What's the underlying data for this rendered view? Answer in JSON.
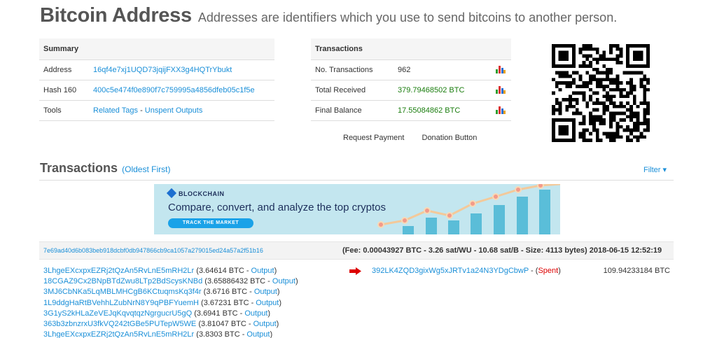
{
  "page": {
    "title": "Bitcoin Address",
    "subtitle": "Addresses are identifiers which you use to send bitcoins to another person."
  },
  "summary": {
    "header": "Summary",
    "address_label": "Address",
    "address_value": "16qf4e7xj1UQD73jqijFXX3g4HQTrYbukt",
    "hash160_label": "Hash 160",
    "hash160_value": "400c5e474f0e890f7c759995a4856dfeb05c1f5e",
    "tools_label": "Tools",
    "tools_link1": "Related Tags",
    "tools_sep": " - ",
    "tools_link2": "Unspent Outputs"
  },
  "transactions_summary": {
    "header": "Transactions",
    "no_tx_label": "No. Transactions",
    "no_tx_value": "962",
    "total_received_label": "Total Received",
    "total_received_value": "379.79468502 BTC",
    "final_balance_label": "Final Balance",
    "final_balance_value": "17.55084862 BTC",
    "chart_icon": "bar-chart-icon"
  },
  "actions": {
    "request_payment": "Request Payment",
    "donation_button": "Donation Button"
  },
  "qr_code": {
    "icon": "qr-code-icon"
  },
  "tx_list": {
    "title": "Transactions",
    "sort_link": "(Oldest First)",
    "filter_label": "Filter ▾"
  },
  "ad": {
    "brand": "BLOCKCHAIN",
    "headline": "Compare, convert, and analyze the top cryptos",
    "cta": "TRACK THE MARKET"
  },
  "tx": {
    "hash": "7e69ad40d6b083beb918dcbf0db947866cb9ca1057a279015ed24a57a2f51b16",
    "fee_info": "(Fee: 0.00043927 BTC - 3.26 sat/WU - 10.68 sat/B - Size: 4113 bytes) 2018-06-15 12:52:19",
    "inputs": [
      {
        "address": "3LhgeEXcxpxEZRj2tQzAn5RvLnE5mRH2Lr",
        "amount": " (3.64614 BTC - ",
        "link": "Output",
        "close": ")"
      },
      {
        "address": "18CGAZ9Cx2BNpBTdZwu8LTp2BdScysKNBd",
        "amount": " (3.65886432 BTC - ",
        "link": "Output",
        "close": ")"
      },
      {
        "address": "3MJ6CbNKa5LqMBLMHCgB6KCtuqmsKq3f4r",
        "amount": " (3.6716 BTC - ",
        "link": "Output",
        "close": ")"
      },
      {
        "address": "1L9ddgHaRtBVehhLZubNrN8Y9qPBFYuemH",
        "amount": " (3.67231 BTC - ",
        "link": "Output",
        "close": ")"
      },
      {
        "address": "3G1yS2kHLaZeVEJqKqvqtqzNgrgucrU5gQ",
        "amount": " (3.6941 BTC - ",
        "link": "Output",
        "close": ")"
      },
      {
        "address": "363b3zbnzrxU3fkVQ242tGBe5PUTepW5WE",
        "amount": " (3.81047 BTC - ",
        "link": "Output",
        "close": ")"
      },
      {
        "address": "3LhgeEXcxpxEZRj2tQzAn5RvLnE5mRH2Lr",
        "amount": " (3.8303 BTC - ",
        "link": "Output",
        "close": ")"
      }
    ],
    "output_address": "392LK4ZQD3gixWg5xJRTv1a24N3YDgCbwP",
    "output_sep": " - (",
    "output_status": "Spent",
    "output_close": ")",
    "output_amount": "109.94233184 BTC",
    "arrow_icon": "right-arrow-icon"
  },
  "colors": {
    "link": "#1a8fd8",
    "green_value": "#1a7d0e",
    "spent": "#dd0000",
    "arrow": "#dd0000"
  }
}
